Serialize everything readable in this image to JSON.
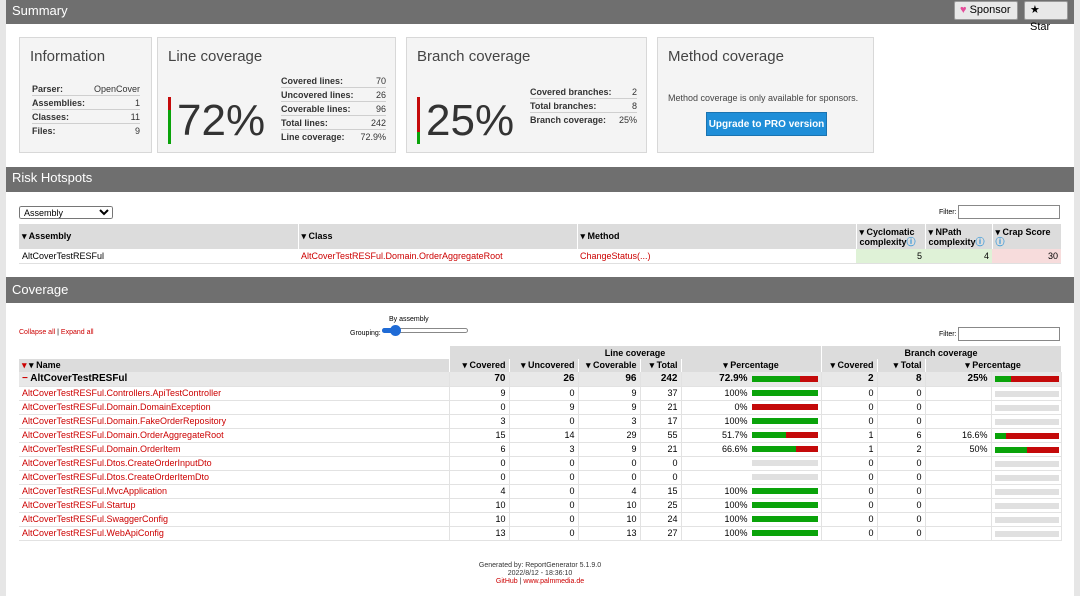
{
  "header": {
    "summary_title": "Summary",
    "sponsor_label": "Sponsor",
    "star_label": "Star"
  },
  "information": {
    "title": "Information",
    "rows": [
      {
        "k": "Parser:",
        "v": "OpenCover"
      },
      {
        "k": "Assemblies:",
        "v": "1"
      },
      {
        "k": "Classes:",
        "v": "11"
      },
      {
        "k": "Files:",
        "v": "9"
      }
    ]
  },
  "line_coverage": {
    "title": "Line coverage",
    "pct": "72%",
    "ratio": 0.72,
    "rows": [
      {
        "k": "Covered lines:",
        "v": "70"
      },
      {
        "k": "Uncovered lines:",
        "v": "26"
      },
      {
        "k": "Coverable lines:",
        "v": "96"
      },
      {
        "k": "Total lines:",
        "v": "242"
      },
      {
        "k": "Line coverage:",
        "v": "72.9%"
      }
    ]
  },
  "branch_coverage": {
    "title": "Branch coverage",
    "pct": "25%",
    "ratio": 0.25,
    "rows": [
      {
        "k": "Covered branches:",
        "v": "2"
      },
      {
        "k": "Total branches:",
        "v": "8"
      },
      {
        "k": "Branch coverage:",
        "v": "25%"
      }
    ]
  },
  "method_coverage": {
    "title": "Method coverage",
    "text": "Method coverage is only available for sponsors.",
    "button": "Upgrade to PRO version"
  },
  "risk": {
    "title": "Risk Hotspots",
    "select_value": "Assembly",
    "filter_label": "Filter:",
    "headers": {
      "assembly": "▾ Assembly",
      "class": "▾ Class",
      "method": "▾ Method",
      "cyclomatic1": "▾ Cyclomatic",
      "cyclomatic2": "complexity",
      "npath1": "▾ NPath",
      "npath2": "complexity",
      "crap": "▾ Crap Score"
    },
    "row": {
      "assembly": "AltCoverTestRESFul",
      "class": "AltCoverTestRESFul.Domain.OrderAggregateRoot",
      "method": "ChangeStatus(...)",
      "cyclomatic": "5",
      "npath": "4",
      "crap": "30"
    }
  },
  "coverage": {
    "title": "Coverage",
    "collapse_all": "Collapse all",
    "separator": "|",
    "expand_all": "Expand all",
    "grouping_label": "Grouping:",
    "grouping_value": "By assembly",
    "filter_label": "Filter:",
    "group_line": "Line coverage",
    "group_branch": "Branch coverage",
    "headers": {
      "name": "▾ Name",
      "covered": "▾ Covered",
      "uncovered": "▾ Uncovered",
      "coverable": "▾ Coverable",
      "total": "▾ Total",
      "percentage": "▾ Percentage",
      "b_covered": "▾ Covered",
      "b_total": "▾ Total",
      "b_percentage": "▾ Percentage"
    },
    "assembly_row": {
      "name": "AltCoverTestRESFul",
      "covered": "70",
      "uncovered": "26",
      "coverable": "96",
      "total": "242",
      "pct": "72.9%",
      "ratio": 0.729,
      "b_covered": "2",
      "b_total": "8",
      "b_pct": "25%",
      "b_ratio": 0.25
    },
    "rows": [
      {
        "name": "AltCoverTestRESFul.Controllers.ApiTestController",
        "covered": "9",
        "uncovered": "0",
        "coverable": "9",
        "total": "37",
        "pct": "100%",
        "ratio": 1.0,
        "b_covered": "0",
        "b_total": "0",
        "b_pct": "",
        "b_ratio": null
      },
      {
        "name": "AltCoverTestRESFul.Domain.DomainException",
        "covered": "0",
        "uncovered": "9",
        "coverable": "9",
        "total": "21",
        "pct": "0%",
        "ratio": 0.0,
        "b_covered": "0",
        "b_total": "0",
        "b_pct": "",
        "b_ratio": null
      },
      {
        "name": "AltCoverTestRESFul.Domain.FakeOrderRepository",
        "covered": "3",
        "uncovered": "0",
        "coverable": "3",
        "total": "17",
        "pct": "100%",
        "ratio": 1.0,
        "b_covered": "0",
        "b_total": "0",
        "b_pct": "",
        "b_ratio": null
      },
      {
        "name": "AltCoverTestRESFul.Domain.OrderAggregateRoot",
        "covered": "15",
        "uncovered": "14",
        "coverable": "29",
        "total": "55",
        "pct": "51.7%",
        "ratio": 0.517,
        "b_covered": "1",
        "b_total": "6",
        "b_pct": "16.6%",
        "b_ratio": 0.166
      },
      {
        "name": "AltCoverTestRESFul.Domain.OrderItem",
        "covered": "6",
        "uncovered": "3",
        "coverable": "9",
        "total": "21",
        "pct": "66.6%",
        "ratio": 0.666,
        "b_covered": "1",
        "b_total": "2",
        "b_pct": "50%",
        "b_ratio": 0.5
      },
      {
        "name": "AltCoverTestRESFul.Dtos.CreateOrderInputDto",
        "covered": "0",
        "uncovered": "0",
        "coverable": "0",
        "total": "0",
        "pct": "",
        "ratio": null,
        "b_covered": "0",
        "b_total": "0",
        "b_pct": "",
        "b_ratio": null
      },
      {
        "name": "AltCoverTestRESFul.Dtos.CreateOrderItemDto",
        "covered": "0",
        "uncovered": "0",
        "coverable": "0",
        "total": "0",
        "pct": "",
        "ratio": null,
        "b_covered": "0",
        "b_total": "0",
        "b_pct": "",
        "b_ratio": null
      },
      {
        "name": "AltCoverTestRESFul.MvcApplication",
        "covered": "4",
        "uncovered": "0",
        "coverable": "4",
        "total": "15",
        "pct": "100%",
        "ratio": 1.0,
        "b_covered": "0",
        "b_total": "0",
        "b_pct": "",
        "b_ratio": null
      },
      {
        "name": "AltCoverTestRESFul.Startup",
        "covered": "10",
        "uncovered": "0",
        "coverable": "10",
        "total": "25",
        "pct": "100%",
        "ratio": 1.0,
        "b_covered": "0",
        "b_total": "0",
        "b_pct": "",
        "b_ratio": null
      },
      {
        "name": "AltCoverTestRESFul.SwaggerConfig",
        "covered": "10",
        "uncovered": "0",
        "coverable": "10",
        "total": "24",
        "pct": "100%",
        "ratio": 1.0,
        "b_covered": "0",
        "b_total": "0",
        "b_pct": "",
        "b_ratio": null
      },
      {
        "name": "AltCoverTestRESFul.WebApiConfig",
        "covered": "13",
        "uncovered": "0",
        "coverable": "13",
        "total": "27",
        "pct": "100%",
        "ratio": 1.0,
        "b_covered": "0",
        "b_total": "0",
        "b_pct": "",
        "b_ratio": null
      }
    ]
  },
  "footer": {
    "generated": "Generated by: ReportGenerator 5.1.9.0",
    "date": "2022/8/12 - 18:36:10",
    "github": "GitHub",
    "sep": "|",
    "site": "www.palmmedia.de"
  },
  "colors": {
    "covered": "#0aa30a",
    "uncovered": "#c40a0a",
    "accent": "#1f8ed8"
  }
}
